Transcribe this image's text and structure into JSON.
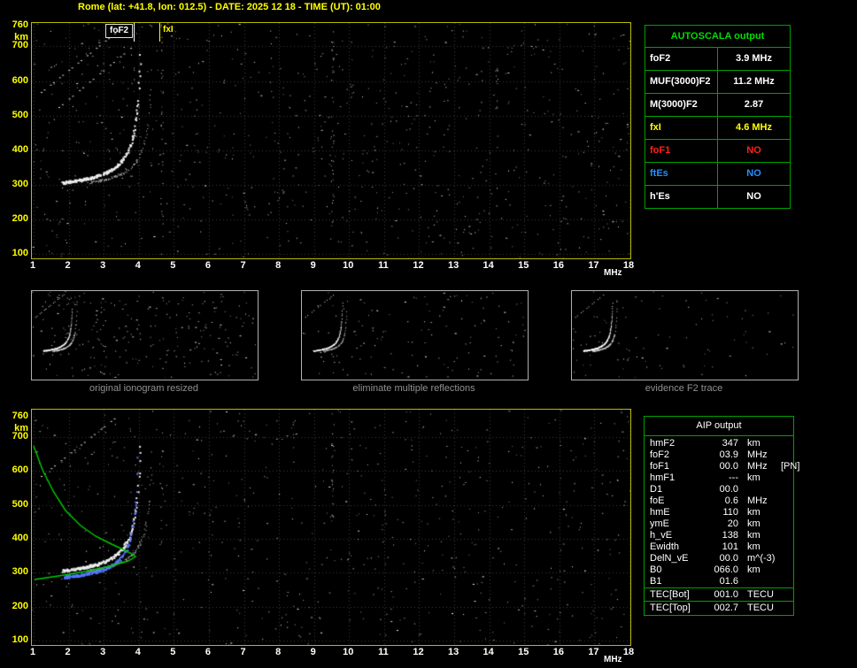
{
  "title": "Rome (lat: +41.8, lon: 012.5) - DATE: 2025 12 18 - TIME (UT): 01:00",
  "colors": {
    "background": "#000000",
    "title": "#ffff00",
    "axis_labels": "#ffff00",
    "plot_border": "#b8b800",
    "table_border": "#00a000",
    "autoscala_header": "#00dd00",
    "profile_green": "#00cc00",
    "restored_trace_blue": "#5577ff",
    "caption_gray": "#909090",
    "fof1_red": "#ff2020",
    "ftes_blue": "#2090ff",
    "fxi_yellow": "#ffff00"
  },
  "axes": {
    "y_unit": "km",
    "x_unit": "MHz",
    "y_ticks": [
      "760",
      "700",
      "600",
      "500",
      "400",
      "300",
      "200",
      "100"
    ],
    "x_ticks": [
      "1",
      "2",
      "3",
      "4",
      "5",
      "6",
      "7",
      "8",
      "9",
      "10",
      "11",
      "12",
      "13",
      "14",
      "15",
      "16",
      "17",
      "18"
    ]
  },
  "top_plot": {
    "foF2_label": "foF2",
    "fxI_label": "fxI"
  },
  "autoscala_table": {
    "header": "AUTOSCALA output",
    "rows": [
      {
        "label": "foF2",
        "value": "3.9 MHz",
        "color": "#ffffff"
      },
      {
        "label": "MUF(3000)F2",
        "value": "11.2 MHz",
        "color": "#ffffff"
      },
      {
        "label": "M(3000)F2",
        "value": "2.87",
        "color": "#ffffff"
      },
      {
        "label": "fxI",
        "value": "4.6 MHz",
        "color": "#ffff00"
      },
      {
        "label": "foF1",
        "value": "NO",
        "color": "#ff2020"
      },
      {
        "label": "ftEs",
        "value": "NO",
        "color": "#2090ff"
      },
      {
        "label": "h'Es",
        "value": "NO",
        "color": "#ffffff"
      }
    ]
  },
  "thumbnails": [
    {
      "caption": "original ionogram resized"
    },
    {
      "caption": "eliminate multiple reflections"
    },
    {
      "caption": "evidence F2 trace"
    }
  ],
  "aip_table": {
    "header": "AIP output",
    "rows": [
      {
        "label": "hmF2",
        "value": "347",
        "unit": "km",
        "note": ""
      },
      {
        "label": "foF2",
        "value": "03.9",
        "unit": "MHz",
        "note": ""
      },
      {
        "label": "foF1",
        "value": "00.0",
        "unit": "MHz",
        "note": "[PN]"
      },
      {
        "label": "hmF1",
        "value": "---",
        "unit": "km",
        "note": ""
      },
      {
        "label": "D1",
        "value": "00.0",
        "unit": "",
        "note": ""
      },
      {
        "label": "foE",
        "value": "0.6",
        "unit": "MHz",
        "note": ""
      },
      {
        "label": "hmE",
        "value": "110",
        "unit": "km",
        "note": ""
      },
      {
        "label": "ymE",
        "value": "20",
        "unit": "km",
        "note": ""
      },
      {
        "label": "h_vE",
        "value": "138",
        "unit": "km",
        "note": ""
      },
      {
        "label": "Ewidth",
        "value": "101",
        "unit": "km",
        "note": ""
      },
      {
        "label": "DelN_vE",
        "value": "00.0",
        "unit": "m^(-3)",
        "note": ""
      },
      {
        "label": "B0",
        "value": "066.0",
        "unit": "km",
        "note": ""
      },
      {
        "label": "B1",
        "value": "01.6",
        "unit": "",
        "note": ""
      },
      {
        "label": "TEC[Bot]",
        "value": "001.0",
        "unit": "TECU",
        "note": "",
        "sep": true
      },
      {
        "label": "TEC[Top]",
        "value": "002.7",
        "unit": "TECU",
        "note": "",
        "sep": true
      }
    ]
  },
  "chart_data": [
    {
      "type": "scatter",
      "title": "Ionogram with autoscaled parameters (top panel)",
      "xlabel": "MHz",
      "ylabel": "km",
      "xlim": [
        1,
        18
      ],
      "ylim": [
        100,
        760
      ],
      "grid": true,
      "series": [
        {
          "name": "F2 O-mode trace",
          "x": [
            1.9,
            2.2,
            2.6,
            3.0,
            3.3,
            3.6,
            3.8,
            3.9,
            4.0,
            4.05
          ],
          "y": [
            300,
            310,
            322,
            335,
            350,
            378,
            412,
            470,
            560,
            640
          ]
        },
        {
          "name": "F2 X-mode trace",
          "x": [
            2.8,
            3.2,
            3.6,
            4.0,
            4.2,
            4.35
          ],
          "y": [
            315,
            330,
            356,
            396,
            470,
            580
          ]
        },
        {
          "name": "spread echoes / noise",
          "x": [],
          "y": [],
          "description": "random scattered white echoes across whole plot, vertical interference streaks near 4.7 and 9.5 MHz, oblique second-hop streaks top-left 600-750 km"
        }
      ],
      "markers": [
        {
          "name": "foF2",
          "x": 3.9
        },
        {
          "name": "fxI",
          "x": 4.6
        }
      ]
    },
    {
      "type": "scatter",
      "title": "Ionogram with restored trace and electron density profile (bottom panel)",
      "xlabel": "MHz",
      "ylabel": "km",
      "xlim": [
        1,
        18
      ],
      "ylim": [
        100,
        760
      ],
      "grid": true,
      "series": [
        {
          "name": "F2 O-mode trace",
          "x": [
            1.9,
            2.2,
            2.6,
            3.0,
            3.3,
            3.6,
            3.8,
            3.9,
            4.0,
            4.05
          ],
          "y": [
            300,
            310,
            322,
            335,
            350,
            378,
            412,
            470,
            560,
            640
          ]
        },
        {
          "name": "restored trace (blue)",
          "x": [
            1.9,
            2.2,
            2.6,
            3.0,
            3.4,
            3.7,
            3.85
          ],
          "y": [
            298,
            306,
            318,
            332,
            352,
            380,
            410
          ]
        },
        {
          "name": "electron density profile (green)",
          "x": [
            1.0,
            1.6,
            2.2,
            2.8,
            3.4,
            3.8,
            3.9,
            3.4,
            2.5,
            1.5,
            1.0
          ],
          "y": [
            665,
            520,
            445,
            402,
            372,
            352,
            347,
            325,
            308,
            295,
            290
          ]
        }
      ],
      "markers": []
    }
  ]
}
